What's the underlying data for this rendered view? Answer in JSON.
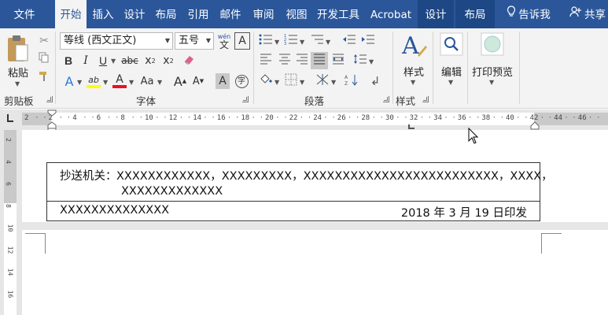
{
  "tabs": [
    {
      "label": "文件",
      "active": false
    },
    {
      "label": "开始",
      "active": true
    },
    {
      "label": "插入",
      "active": false
    },
    {
      "label": "设计",
      "active": false
    },
    {
      "label": "布局",
      "active": false
    },
    {
      "label": "引用",
      "active": false
    },
    {
      "label": "邮件",
      "active": false
    },
    {
      "label": "审阅",
      "active": false
    },
    {
      "label": "视图",
      "active": false
    },
    {
      "label": "开发工具",
      "active": false
    },
    {
      "label": "Acrobat",
      "active": false
    },
    {
      "label": "设计",
      "active": false,
      "contextual": true
    },
    {
      "label": "布局",
      "active": false,
      "contextual": true
    }
  ],
  "tell_me": "告诉我",
  "share": "共享",
  "ribbon": {
    "clipboard": {
      "paste": "粘贴",
      "group": "剪贴板"
    },
    "font": {
      "font_name": "等线 (西文正文)",
      "font_size": "五号",
      "wen_top": "wén",
      "wen_bottom": "文",
      "box_a": "A",
      "bold": "B",
      "italic": "I",
      "underline": "U",
      "strike": "abc",
      "subscript": "x",
      "subscript_mark": "2",
      "superscript": "x",
      "superscript_mark": "2",
      "text_effect": "A",
      "highlight": "ab",
      "font_color": "A",
      "change_case": "Aa",
      "grow": "A",
      "shrink": "A",
      "char_shading": "A",
      "enclose": "字",
      "group": "字体"
    },
    "paragraph": {
      "group": "段落"
    },
    "styles": {
      "label": "样式",
      "group": "样式"
    },
    "editing": {
      "label": "编辑"
    },
    "print_preview": {
      "label": "打印预览"
    }
  },
  "ruler": {
    "ticks": [
      "2",
      "2",
      "4",
      "6",
      "8",
      "10",
      "12",
      "14",
      "16",
      "18",
      "20",
      "22",
      "24",
      "26",
      "28",
      "30",
      "32",
      "34",
      "36",
      "38",
      "40",
      "42",
      "44",
      "46"
    ]
  },
  "vruler": {
    "ticks": [
      "2",
      "4",
      "6",
      "8",
      "10",
      "12",
      "14",
      "16"
    ]
  },
  "document": {
    "cc_label": "抄送机关：",
    "cc_line1": "XXXXXXXXXXXX，XXXXXXXXX，XXXXXXXXXXXXXXXXXXXXXXXXX，XXXX，",
    "cc_line2": "XXXXXXXXXXXXX",
    "issuer": "XXXXXXXXXXXXXX",
    "issue_date": "2018 年 3 月 19 日印发"
  },
  "colors": {
    "title_bar": "#2b579a",
    "ribbon_bg": "#f3f3f3",
    "ruler_bg": "#e6e6e6",
    "highlight_yellow": "#ffff00",
    "font_red": "#e81123",
    "accent_blue": "#2b579a"
  }
}
